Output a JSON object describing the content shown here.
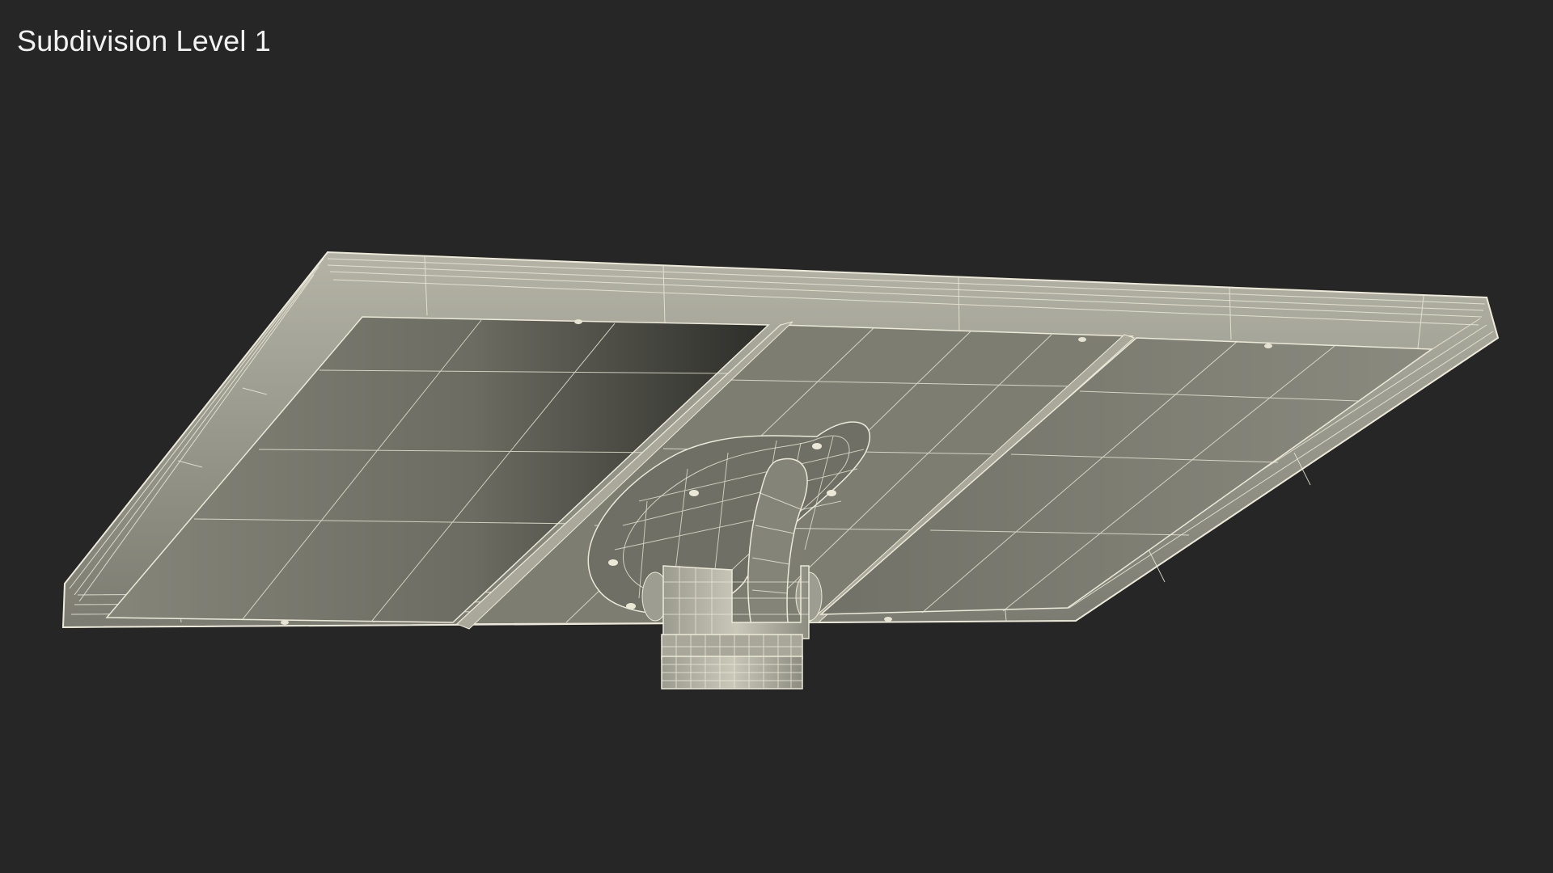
{
  "caption": {
    "text": "Subdivision Level 1"
  },
  "scene": {
    "subject": "solar-panel-with-pole-mount-wireframe",
    "colors": {
      "background": "#262626",
      "surface": "#7c7c70",
      "surface_dark": "#3e3e37",
      "wire": "#ece9d8",
      "frame": "#9a9a8e"
    }
  }
}
